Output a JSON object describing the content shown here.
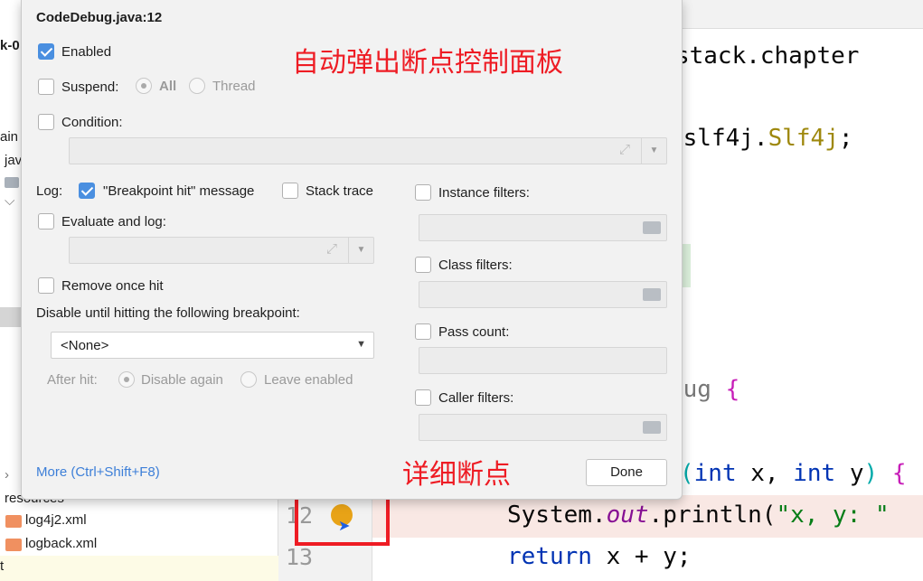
{
  "project_tree": {
    "items": [
      "k-0",
      "ain",
      "jav",
      "resources",
      "log4j2.xml",
      "logback.xml",
      "t"
    ]
  },
  "editor": {
    "lines": [
      {
        "text": "og.stack.chapter"
      },
      {
        "text": ".slf4j.",
        "cls": "Slf4j",
        ";": ";"
      },
      {
        "text": "bug ",
        "brace": "{"
      },
      {
        "open": "(",
        "kw1": "int",
        "v1": " x, ",
        "kw2": "int",
        "v2": " y",
        ") ": ") ",
        "brace": "{"
      },
      {
        "number": "12",
        "a": "System.",
        "b": "out",
        "c": ".println(",
        "d": "\"x, y: \""
      },
      {
        "number": "13",
        "kw": "return",
        "rest": " x + y;"
      }
    ]
  },
  "popup": {
    "title": "CodeDebug.java:12",
    "enabled": {
      "label": "Enabled",
      "checked": true
    },
    "suspend": {
      "label": "Suspend:",
      "checked": false,
      "options": [
        "All",
        "Thread"
      ],
      "selected": "All"
    },
    "condition": {
      "label": "Condition:",
      "checked": false,
      "value": ""
    },
    "log": {
      "label": "Log:",
      "message_label": "\"Breakpoint hit\" message",
      "message_checked": true,
      "stack_label": "Stack trace",
      "stack_checked": false
    },
    "evaluate": {
      "label": "Evaluate and log:",
      "checked": false,
      "value": ""
    },
    "remove_once": {
      "label": "Remove once hit",
      "checked": false
    },
    "disable_until": {
      "label": "Disable until hitting the following breakpoint:",
      "selected": "<None>"
    },
    "after_hit": {
      "label": "After hit:",
      "options": [
        "Disable again",
        "Leave enabled"
      ],
      "selected": "Disable again"
    },
    "instance_filters": {
      "label": "Instance filters:",
      "checked": false
    },
    "class_filters": {
      "label": "Class filters:",
      "checked": false
    },
    "pass_count": {
      "label": "Pass count:",
      "checked": false
    },
    "caller_filters": {
      "label": "Caller filters:",
      "checked": false
    },
    "more_link": "More (Ctrl+Shift+F8)",
    "done_button": "Done"
  },
  "annotations": {
    "top": "自动弹出断点控制面板",
    "bottom": "详细断点"
  },
  "colors": {
    "accent": "#4a8fe0",
    "annotation": "#ee1c24",
    "link": "#3d7fd8",
    "keyword": "#0033b3",
    "breakpoint": "#e8a317"
  }
}
